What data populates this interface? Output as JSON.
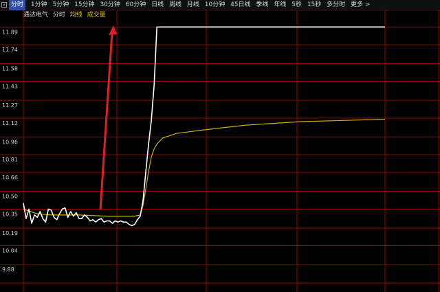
{
  "tabs": [
    "分时",
    "1分钟",
    "5分钟",
    "15分钟",
    "30分钟",
    "60分钟",
    "日线",
    "周线",
    "月线",
    "10分钟",
    "45日线",
    "季线",
    "年线",
    "5秒",
    "15秒",
    "多分时"
  ],
  "active_tab": "分时",
  "more_label": "更多 >",
  "legend": {
    "stock_name": "通达电气",
    "view": "分时",
    "avg_label": "均线",
    "volume_label": "成交量"
  },
  "colors": {
    "grid": "#9b0000",
    "price_line": "#ffffff",
    "avg_line": "#c8b400",
    "arrow": "#e02020",
    "active_tab_bg": "#2f4fa8"
  },
  "chart_data": {
    "type": "line",
    "y_ticks": [
      "11.89",
      "11.74",
      "11.58",
      "11.43",
      "11.27",
      "11.12",
      "10.96",
      "10.81",
      "10.66",
      "10.50",
      "10.35",
      "10.19",
      "10.04",
      "9.88"
    ],
    "ylim": [
      9.73,
      11.95
    ],
    "series": [
      {
        "points": [
          [
            0,
            10.4
          ],
          [
            2,
            10.27
          ],
          [
            4,
            10.35
          ],
          [
            6,
            10.23
          ],
          [
            8,
            10.3
          ],
          [
            10,
            10.28
          ],
          [
            12,
            10.33
          ],
          [
            14,
            10.27
          ],
          [
            16,
            10.24
          ],
          [
            18,
            10.35
          ],
          [
            20,
            10.34
          ],
          [
            22,
            10.28
          ],
          [
            24,
            10.26
          ],
          [
            26,
            10.31
          ],
          [
            28,
            10.35
          ],
          [
            30,
            10.36
          ],
          [
            32,
            10.28
          ],
          [
            34,
            10.33
          ],
          [
            36,
            10.29
          ],
          [
            38,
            10.32
          ],
          [
            40,
            10.27
          ],
          [
            42,
            10.27
          ],
          [
            44,
            10.3
          ],
          [
            46,
            10.28
          ],
          [
            48,
            10.25
          ],
          [
            50,
            10.26
          ],
          [
            52,
            10.24
          ],
          [
            54,
            10.26
          ],
          [
            56,
            10.27
          ],
          [
            58,
            10.24
          ],
          [
            60,
            10.25
          ],
          [
            62,
            10.25
          ],
          [
            64,
            10.23
          ],
          [
            66,
            10.25
          ],
          [
            68,
            10.24
          ],
          [
            70,
            10.25
          ],
          [
            72,
            10.24
          ],
          [
            74,
            10.24
          ],
          [
            76,
            10.22
          ],
          [
            78,
            10.21
          ],
          [
            80,
            10.22
          ],
          [
            82,
            10.26
          ],
          [
            84,
            10.29
          ],
          [
            86,
            10.42
          ],
          [
            88,
            10.66
          ],
          [
            90,
            10.9
          ],
          [
            92,
            11.1
          ],
          [
            94,
            11.4
          ],
          [
            96,
            11.89
          ],
          [
            260,
            11.89
          ]
        ]
      },
      {
        "points": [
          [
            0,
            10.35
          ],
          [
            10,
            10.31
          ],
          [
            20,
            10.3
          ],
          [
            40,
            10.3
          ],
          [
            60,
            10.29
          ],
          [
            80,
            10.29
          ],
          [
            84,
            10.3
          ],
          [
            86,
            10.38
          ],
          [
            88,
            10.52
          ],
          [
            90,
            10.67
          ],
          [
            92,
            10.79
          ],
          [
            94,
            10.86
          ],
          [
            96,
            10.9
          ],
          [
            100,
            10.95
          ],
          [
            110,
            10.99
          ],
          [
            130,
            11.02
          ],
          [
            160,
            11.06
          ],
          [
            200,
            11.09
          ],
          [
            230,
            11.1
          ],
          [
            260,
            11.11
          ]
        ]
      }
    ]
  }
}
